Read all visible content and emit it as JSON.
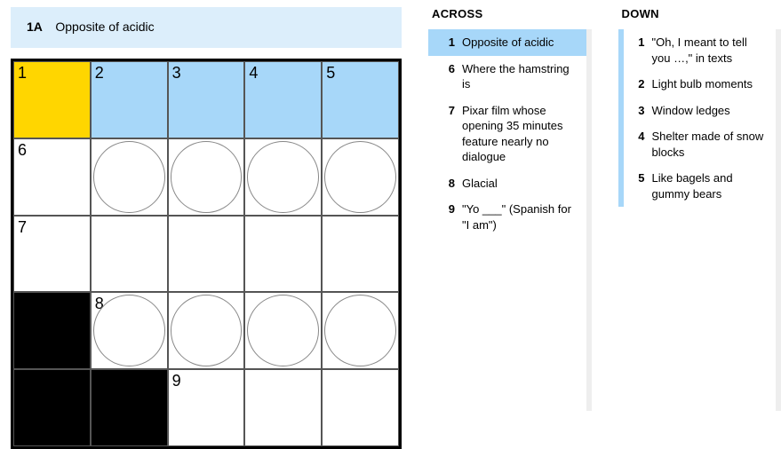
{
  "current_clue": {
    "label": "1A",
    "text": "Opposite of acidic"
  },
  "grid": {
    "size": 5,
    "cells": [
      [
        {
          "n": "1",
          "state": "yellow"
        },
        {
          "n": "2",
          "state": "blue"
        },
        {
          "n": "3",
          "state": "blue"
        },
        {
          "n": "4",
          "state": "blue"
        },
        {
          "n": "5",
          "state": "blue"
        }
      ],
      [
        {
          "n": "6"
        },
        {
          "circle": true
        },
        {
          "circle": true
        },
        {
          "circle": true
        },
        {
          "circle": true
        }
      ],
      [
        {
          "n": "7"
        },
        {},
        {},
        {},
        {}
      ],
      [
        {
          "state": "black"
        },
        {
          "n": "8",
          "circle": true
        },
        {
          "circle": true
        },
        {
          "circle": true
        },
        {
          "circle": true
        }
      ],
      [
        {
          "state": "black"
        },
        {
          "state": "black"
        },
        {
          "n": "9"
        },
        {},
        {}
      ]
    ]
  },
  "across": {
    "title": "ACROSS",
    "clues": [
      {
        "num": "1",
        "text": "Opposite of acidic",
        "selected": true
      },
      {
        "num": "6",
        "text": "Where the hamstring is"
      },
      {
        "num": "7",
        "text": "Pixar film whose opening 35 minutes feature nearly no dialogue"
      },
      {
        "num": "8",
        "text": "Glacial"
      },
      {
        "num": "9",
        "text": "\"Yo ___\" (Spanish for \"I am\")"
      }
    ]
  },
  "down": {
    "title": "DOWN",
    "clues": [
      {
        "num": "1",
        "text": "\"Oh, I meant to tell you …,\" in texts",
        "related": true
      },
      {
        "num": "2",
        "text": "Light bulb moments",
        "related": true
      },
      {
        "num": "3",
        "text": "Window ledges",
        "related": true
      },
      {
        "num": "4",
        "text": "Shelter made of snow blocks",
        "related": true
      },
      {
        "num": "5",
        "text": "Like bagels and gummy bears",
        "related": true
      }
    ]
  }
}
